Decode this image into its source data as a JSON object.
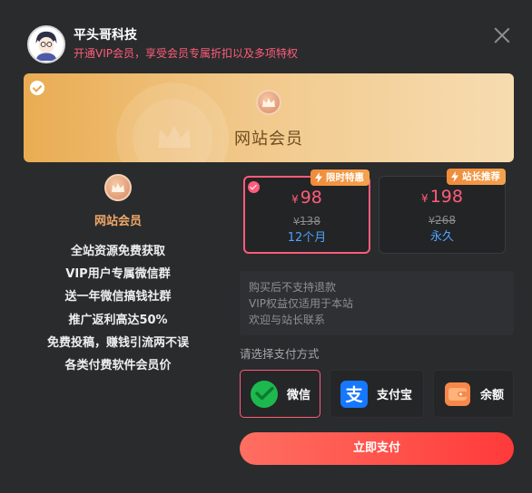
{
  "header": {
    "site_name": "平头哥科技",
    "subtitle": "开通VIP会员，享受会员专属折扣以及多项特权"
  },
  "banner": {
    "title": "网站会员"
  },
  "left_panel": {
    "title": "网站会员",
    "benefits": [
      "全站资源免费获取",
      "VIP用户专属微信群",
      "送一年微信搞钱社群",
      "推广返利高达50%",
      "免费投稿，赚钱引流两不误",
      "各类付费软件会员价"
    ]
  },
  "plans": [
    {
      "tag": "限时特惠",
      "currency": "¥",
      "price": "98",
      "original_price": "138",
      "duration": "12个月",
      "selected": true
    },
    {
      "tag": "站长推荐",
      "currency": "¥",
      "price": "198",
      "original_price": "268",
      "duration": "永久",
      "selected": false
    }
  ],
  "notes": [
    "购买后不支持退款",
    "VIP权益仅适用于本站",
    "欢迎与站长联系"
  ],
  "payment": {
    "label": "请选择支付方式",
    "methods": [
      {
        "label": "微信",
        "icon": "wechat-pay-icon",
        "selected": true
      },
      {
        "label": "支付宝",
        "icon": "alipay-icon",
        "selected": false
      },
      {
        "label": "余额",
        "icon": "wallet-icon",
        "selected": false
      }
    ],
    "submit_label": "立即支付"
  },
  "colors": {
    "accent": "#ff5c7a",
    "gold": "#f0a867",
    "link_blue": "#4da3ff",
    "tag_orange": "#f08b3a",
    "button_start": "#ff6f61",
    "button_end": "#ff3a3a"
  }
}
